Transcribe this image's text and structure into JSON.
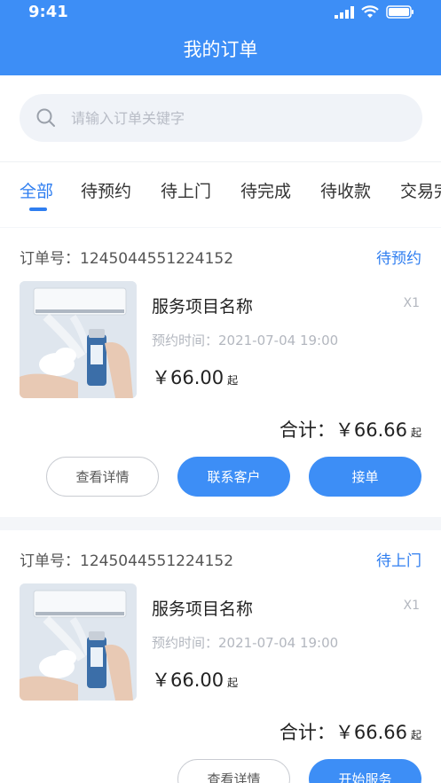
{
  "status_bar": {
    "time": "9:41"
  },
  "header": {
    "title": "我的订单"
  },
  "search": {
    "placeholder": "请输入订单关键字"
  },
  "tabs": [
    {
      "label": "全部",
      "active": true
    },
    {
      "label": "待预约"
    },
    {
      "label": "待上门"
    },
    {
      "label": "待完成"
    },
    {
      "label": "待收款"
    },
    {
      "label": "交易完"
    }
  ],
  "orders": [
    {
      "order_no_label": "订单号：1245044551224152",
      "status": "待预约",
      "item_name": "服务项目名称",
      "qty": "X1",
      "appointment": "预约时间：2021-07-04  19:00",
      "price": "￥66.00",
      "price_suffix": "起",
      "total_label": "合计：￥66.66",
      "total_suffix": "起",
      "buttons": [
        "查看详情",
        "联系客户",
        "接单"
      ]
    },
    {
      "order_no_label": "订单号：1245044551224152",
      "status": "待上门",
      "item_name": "服务项目名称",
      "qty": "X1",
      "appointment": "预约时间：2021-07-04  19:00",
      "price": "￥66.00",
      "price_suffix": "起",
      "total_label": "合计：￥66.66",
      "total_suffix": "起",
      "buttons": [
        "查看详情",
        "开始服务"
      ]
    }
  ],
  "colors": {
    "primary": "#3d8ef6",
    "accent_text": "#2f7ef0"
  }
}
